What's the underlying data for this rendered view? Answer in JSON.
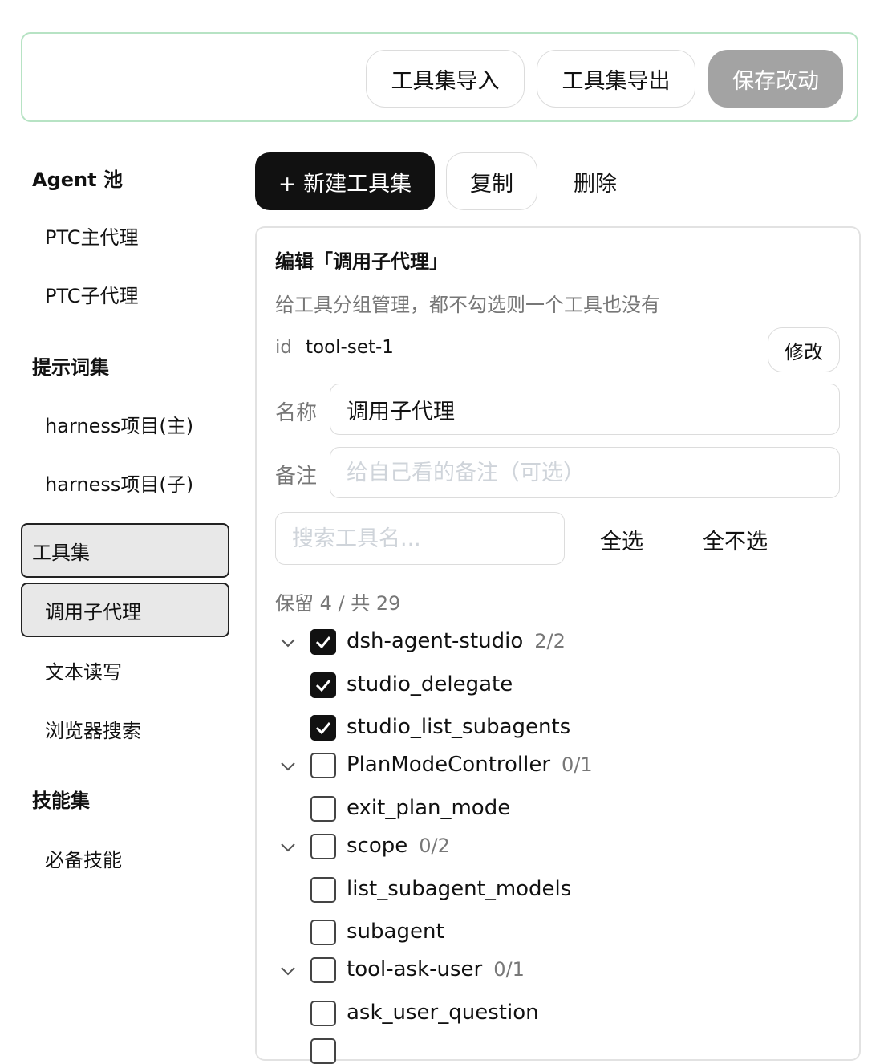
{
  "toolbar": {
    "import_label": "工具集导入",
    "export_label": "工具集导出",
    "save_label": "保存改动"
  },
  "sidebar": {
    "agent_pool": {
      "title": "Agent 池",
      "items": [
        "PTC主代理",
        "PTC子代理"
      ]
    },
    "prompt_sets": {
      "title": "提示词集",
      "items": [
        "harness项目(主)",
        "harness项目(子)"
      ]
    },
    "tool_sets": {
      "title": "工具集",
      "items": [
        "调用子代理",
        "文本读写",
        "浏览器搜索"
      ],
      "selected": "调用子代理"
    },
    "skill_sets": {
      "title": "技能集",
      "items": [
        "必备技能"
      ]
    }
  },
  "actions": {
    "new_label": "+ 新建工具集",
    "copy_label": "复制",
    "delete_label": "删除"
  },
  "editor": {
    "title": "编辑「调用子代理」",
    "description": "给工具分组管理，都不勾选则一个工具也没有",
    "id_label": "id",
    "id_value": "tool-set-1",
    "modify_label": "修改",
    "name_label": "名称",
    "name_value": "调用子代理",
    "note_label": "备注",
    "note_placeholder": "给自己看的备注（可选）",
    "search_placeholder": "搜索工具名...",
    "select_all": "全选",
    "select_none": "全不选",
    "count_text": "保留 4 / 共 29"
  },
  "tools": [
    {
      "kind": "group",
      "name": "dsh-agent-studio",
      "count": "2/2",
      "checked": true
    },
    {
      "kind": "tool",
      "name": "studio_delegate",
      "checked": true
    },
    {
      "kind": "tool",
      "name": "studio_list_subagents",
      "checked": true
    },
    {
      "kind": "group",
      "name": "PlanModeController",
      "count": "0/1",
      "checked": false
    },
    {
      "kind": "tool",
      "name": "exit_plan_mode",
      "checked": false
    },
    {
      "kind": "group",
      "name": "scope",
      "count": "0/2",
      "checked": false
    },
    {
      "kind": "tool",
      "name": "list_subagent_models",
      "checked": false
    },
    {
      "kind": "tool",
      "name": "subagent",
      "checked": false
    },
    {
      "kind": "group",
      "name": "tool-ask-user",
      "count": "0/1",
      "checked": false
    },
    {
      "kind": "tool",
      "name": "ask_user_question",
      "checked": false
    }
  ]
}
